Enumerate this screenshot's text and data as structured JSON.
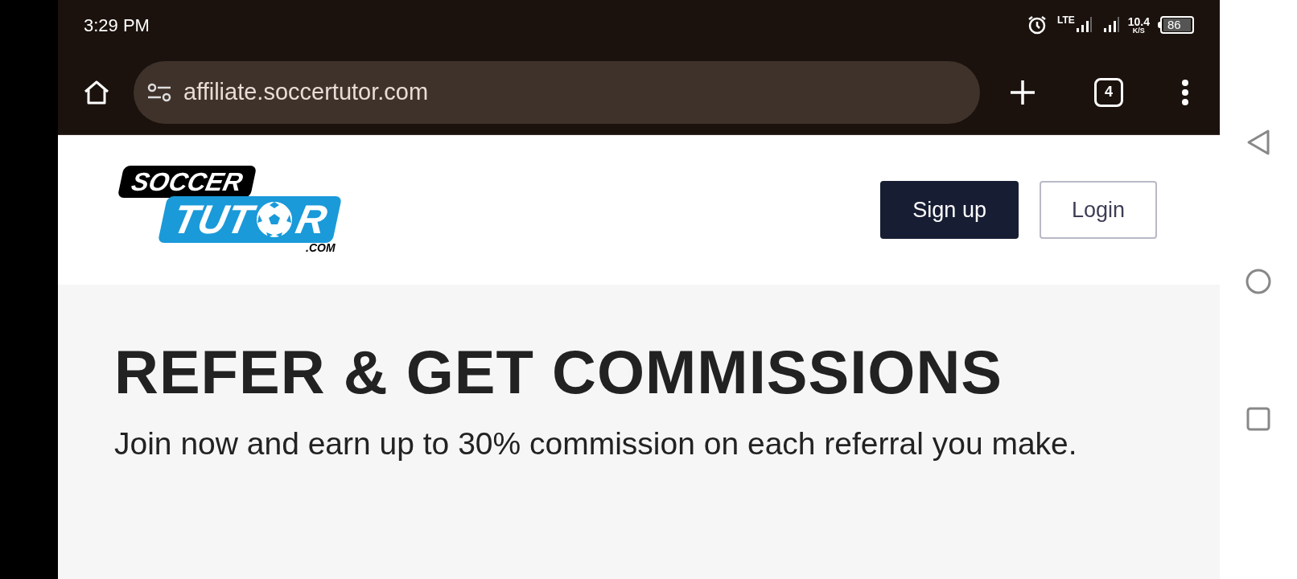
{
  "status_bar": {
    "time": "3:29 PM",
    "network": "LTE",
    "speed": "10.4",
    "speed_unit": "K/S",
    "battery": "86"
  },
  "browser": {
    "url": "affiliate.soccertutor.com",
    "tab_count": "4"
  },
  "header": {
    "logo": {
      "top": "SOCCER",
      "bottom_left": "TUT",
      "bottom_right": "R",
      "suffix": ".COM"
    },
    "buttons": [
      {
        "kind": "primary",
        "label": "Sign up"
      },
      {
        "kind": "outline",
        "label": "Login"
      }
    ]
  },
  "hero": {
    "title": "REFER & GET COMMISSIONS",
    "text": "Join now and earn up to 30% commission on each referral you make."
  }
}
